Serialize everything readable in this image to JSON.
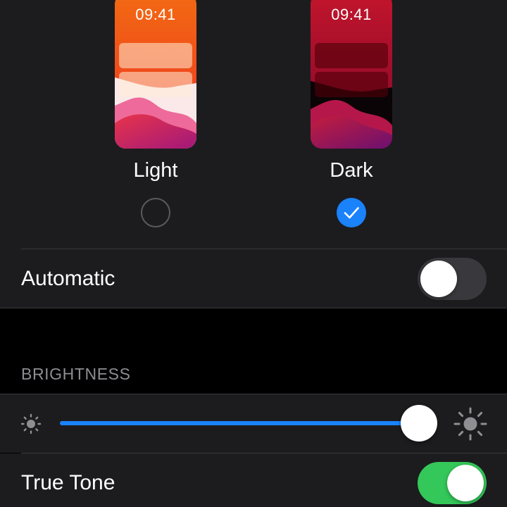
{
  "appearance": {
    "options": [
      {
        "label": "Light",
        "time": "09:41",
        "selected": false
      },
      {
        "label": "Dark",
        "time": "09:41",
        "selected": true
      }
    ],
    "automatic": {
      "label": "Automatic",
      "enabled": false
    }
  },
  "brightness": {
    "header": "BRIGHTNESS",
    "level": 1.0,
    "icons": [
      "brightness-low-icon",
      "brightness-high-icon"
    ]
  },
  "true_tone": {
    "label": "True Tone",
    "enabled": true
  },
  "colors": {
    "accent": "#1a82fb",
    "toggle_on": "#34c759",
    "toggle_off": "#39393d",
    "group_background": "#1c1c1e",
    "page_background": "#000000",
    "section_header": "#8d8d93"
  }
}
